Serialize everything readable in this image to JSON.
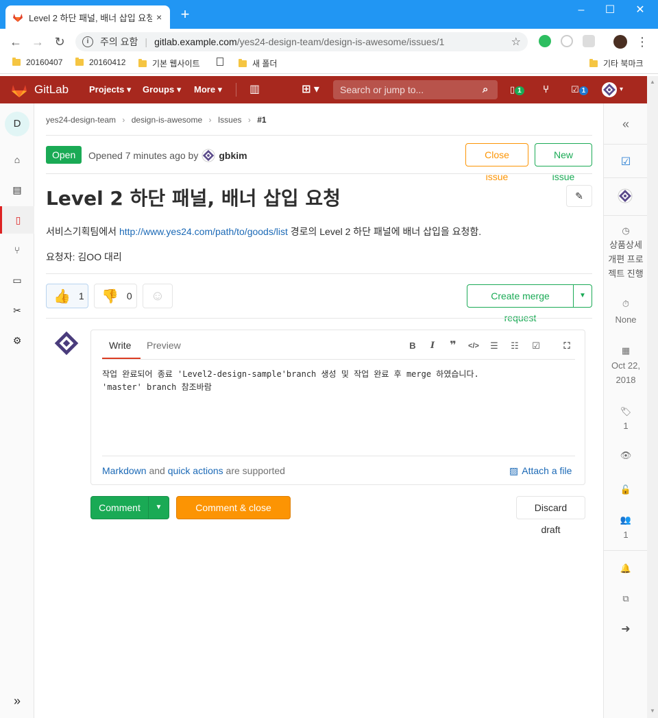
{
  "browser": {
    "tab_title": "Level 2 하단 패널, 배너 삽입 요청 - ",
    "tab_close": "×",
    "new_tab": "+",
    "security_label": "주의 요함",
    "url_host": "gitlab.example.com",
    "url_path": "/yes24-design-team/design-is-awesome/issues/1",
    "bookmarks": [
      "20160407",
      "20160412",
      "기본 웹사이트",
      "새 폴더"
    ],
    "other_bookmarks": "기타 북마크"
  },
  "gitlab": {
    "brand": "GitLab",
    "nav": [
      "Projects",
      "Groups",
      "More"
    ],
    "search_placeholder": "Search or jump to...",
    "issues_count": "1",
    "todos_count": "1"
  },
  "project_avatar_letter": "D",
  "breadcrumb": [
    "yes24-design-team",
    "design-is-awesome",
    "Issues",
    "#1"
  ],
  "issue": {
    "status": "Open",
    "opened_text": "Opened 7 minutes ago by",
    "author": "gbkim",
    "close_label": "Close issue",
    "new_label": "New issue",
    "title": "Level 2 하단 패널, 배너 삽입 요청",
    "desc_before": "서비스기획팀에서 ",
    "desc_link": "http://www.yes24.com/path/to/goods/list",
    "desc_after": " 경로의 Level 2 하단 패널에 배너 삽입을 요청함.",
    "requester": "요청자: 김OO 대리",
    "thumbs_up": "1",
    "thumbs_down": "0",
    "merge_label": "Create merge request"
  },
  "editor": {
    "tab_write": "Write",
    "tab_preview": "Preview",
    "text_line1": "작업 완료되어 종료 'Level2-design-sample'branch 생성 및 작업 완료 후 merge 하였습니다.",
    "text_line2": "'master' branch 참조바람",
    "markdown_link": "Markdown",
    "and_text": " and ",
    "quick_actions_link": "quick actions",
    "supported_text": " are supported",
    "attach_label": "Attach a file"
  },
  "actions": {
    "comment": "Comment",
    "comment_close": "Comment & close issue",
    "discard": "Discard draft"
  },
  "sidebar": {
    "milestone": "상품상세 개편 프로젝트 진행",
    "time": "None",
    "due_date_1": "Oct 22,",
    "due_date_2": "2018",
    "labels_count": "1",
    "participants_count": "1"
  },
  "colors": {
    "header": "#a7281e",
    "green": "#1aaa55",
    "orange": "#fc9403",
    "link": "#1b69b6"
  }
}
